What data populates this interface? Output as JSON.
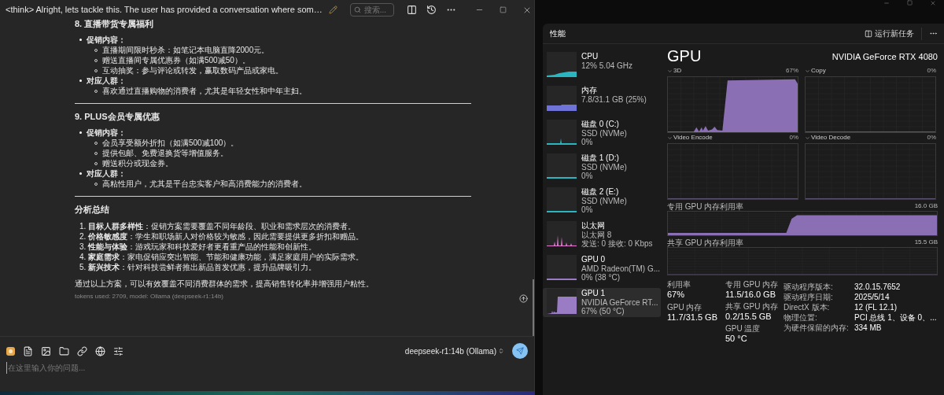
{
  "chat": {
    "title": "<think> Alright, lets tackle this. The user has provided a conversation where som…",
    "search": {
      "placeholder": "搜索..."
    },
    "sections": [
      {
        "heading": "8. 直播带货专属福利",
        "items": [
          {
            "label": "促销内容：",
            "subitems": [
              "直播期间限时秒杀：如笔记本电脑直降2000元。",
              "赠送直播间专属优惠券（如满500减50）。",
              "互动抽奖：参与评论或转发，赢取数码产品或家电。"
            ]
          },
          {
            "label": "对应人群：",
            "subitems": [
              "喜欢通过直播购物的消费者，尤其是年轻女性和中年主妇。"
            ]
          }
        ]
      },
      {
        "heading": "9. PLUS会员专属优惠",
        "items": [
          {
            "label": "促销内容：",
            "subitems": [
              "会员享受额外折扣（如满500减100）。",
              "提供包邮、免费退换货等增值服务。",
              "赠送积分或现金券。"
            ]
          },
          {
            "label": "对应人群：",
            "subitems": [
              "高粘性用户，尤其是平台忠实客户和高消费能力的消费者。"
            ]
          }
        ]
      }
    ],
    "summary": {
      "heading": "分析总结",
      "points": [
        {
          "marker": "1.",
          "text": "**目标人群多样性**：促销方案需要覆盖不同年龄段、职业和需求层次的消费者。"
        },
        {
          "marker": "2.",
          "text": "**价格敏感度**：学生和职场新人对价格较为敏感，因此需要提供更多折扣和赠品。"
        },
        {
          "marker": "3.",
          "text": "**性能与体验**：游戏玩家和科技爱好者更看重产品的性能和创新性。"
        },
        {
          "marker": "4.",
          "text": "**家庭需求**：家电促销应突出智能、节能和健康功能，满足家庭用户的实际需求。"
        },
        {
          "marker": "5.",
          "text": "**新兴技术**：针对科技尝鲜者推出新品首发优惠，提升品牌吸引力。"
        }
      ]
    },
    "conclusion": "通过以上方案，可以有效覆盖不同消费群体的需求，提高销售转化率并增强用户粘性。",
    "meta": "tokens used: 2709, model: Ollama (deepseek-r1:14b)",
    "model": "deepseek-r1:14b (Ollama)",
    "input": {
      "placeholder": "在这里输入你的问题..."
    }
  },
  "taskmanager": {
    "title": "性能",
    "run_task": "运行新任务",
    "sidebar": [
      {
        "kind": "cpu",
        "color": "#2bb5c0",
        "name": "CPU",
        "lines": [
          "12%  5.04 GHz"
        ],
        "selected": false
      },
      {
        "kind": "memory",
        "color": "#6f72d6",
        "name": "内存",
        "lines": [
          "7.8/31.1 GB (25%)"
        ],
        "selected": false
      },
      {
        "kind": "disk",
        "color": "#2bb5c0",
        "name": "磁盘 0 (C:)",
        "lines": [
          "SSD (NVMe)",
          "0%"
        ],
        "selected": false
      },
      {
        "kind": "idle",
        "color": "#2bb5c0",
        "name": "磁盘 1 (D:)",
        "lines": [
          "SSD (NVMe)",
          "0%"
        ],
        "selected": false
      },
      {
        "kind": "idle",
        "color": "#2bb5c0",
        "name": "磁盘 2 (E:)",
        "lines": [
          "SSD (NVMe)",
          "0%"
        ],
        "selected": false
      },
      {
        "kind": "network",
        "color": "#e07bd0",
        "name": "以太网",
        "lines": [
          "以太网 8",
          "发送: 0 接收: 0 Kbps"
        ],
        "selected": false
      },
      {
        "kind": "idle",
        "color": "#9a7cc4",
        "name": "GPU 0",
        "lines": [
          "AMD Radeon(TM) G...",
          "0% (38 °C)"
        ],
        "selected": false
      },
      {
        "kind": "gpu",
        "color": "#9a7cc4",
        "name": "GPU 1",
        "lines": [
          "NVIDIA GeForce RT...",
          "67% (50 °C)"
        ],
        "selected": true
      }
    ],
    "gpu": {
      "title": "GPU",
      "model": "NVIDIA GeForce RTX 4080",
      "engines": [
        {
          "kind": "load",
          "label": "3D",
          "value": "67%"
        },
        {
          "kind": "idle",
          "label": "Copy",
          "value": "0%"
        },
        {
          "kind": "idle",
          "label": "Video Encode",
          "value": "0%"
        },
        {
          "kind": "idle",
          "label": "Video Decode",
          "value": "0%"
        }
      ],
      "memory_graphs": [
        {
          "kind": "step",
          "label": "专用 GPU 内存利用率",
          "value": "16.0 GB"
        },
        {
          "kind": "idle",
          "label": "共享 GPU 内存利用率",
          "value": "15.5 GB"
        }
      ],
      "stats_left": [
        {
          "label": "利用率",
          "value": "67%"
        },
        {
          "label": "GPU 内存",
          "value": "11.7/31.5 GB"
        }
      ],
      "stats_mid": [
        {
          "label": "专用 GPU 内存",
          "value": "11.5/16.0 GB"
        },
        {
          "label": "共享 GPU 内存",
          "value": "0.2/15.5 GB"
        },
        {
          "label": "GPU 温度",
          "value": "50 °C"
        }
      ],
      "properties": [
        {
          "label": "驱动程序版本:",
          "value": "32.0.15.7652"
        },
        {
          "label": "驱动程序日期:",
          "value": "2025/5/14"
        },
        {
          "label": "DirectX 版本:",
          "value": "12 (FL 12.1)"
        },
        {
          "label": "物理位置:",
          "value": "PCI 总线 1、设备 0、..."
        },
        {
          "label": "为硬件保留的内存:",
          "value": "334 MB"
        }
      ]
    }
  }
}
